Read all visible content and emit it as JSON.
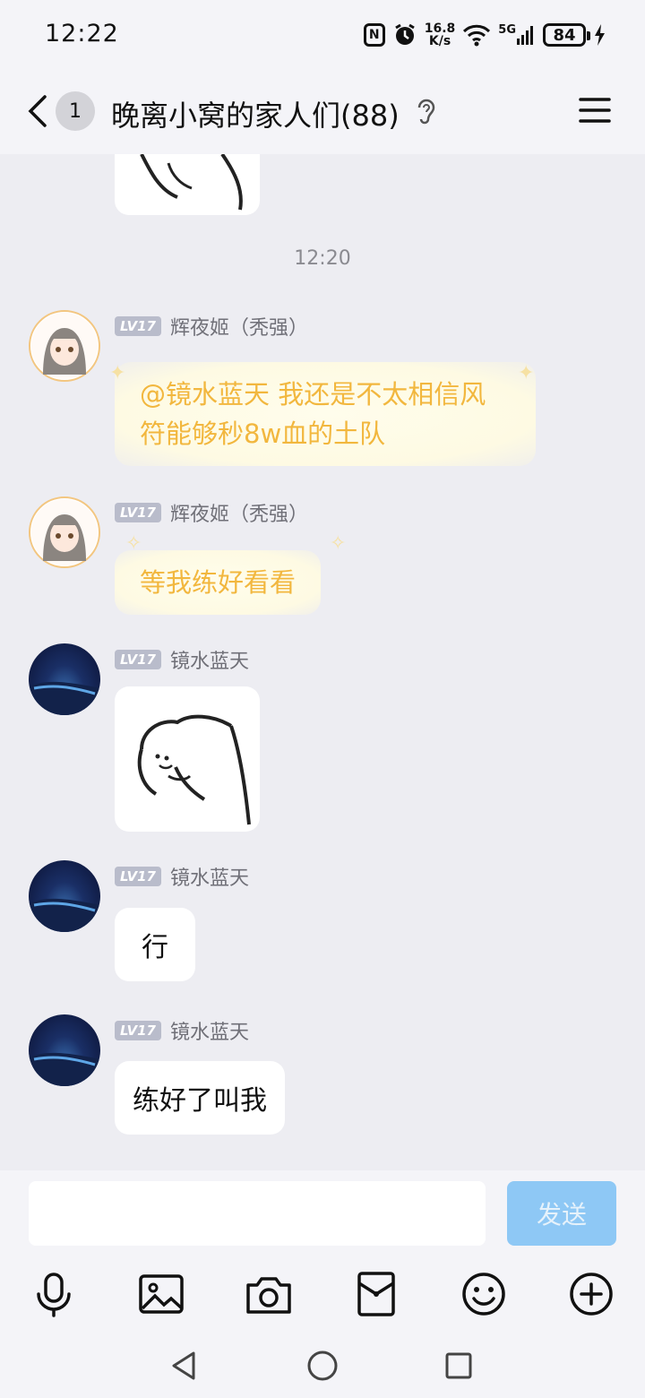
{
  "status_bar": {
    "time": "12:22",
    "nfc": "N",
    "speed_top": "16.8",
    "speed_bottom": "K/s",
    "network": "5G",
    "battery": "84"
  },
  "header": {
    "unread_count": "1",
    "title": "晚离小窝的家人们(88)"
  },
  "messages": {
    "time_divider": "12:20",
    "items": [
      {
        "level": "LV17",
        "sender": "辉夜姬（秃强）",
        "text": "@镜水蓝天 我还是不太相信风符能够秒8w血的土队"
      },
      {
        "level": "LV17",
        "sender": "辉夜姬（秃强）",
        "text": "等我练好看看"
      },
      {
        "level": "LV17",
        "sender": "镜水蓝天"
      },
      {
        "level": "LV17",
        "sender": "镜水蓝天",
        "text": "行"
      },
      {
        "level": "LV17",
        "sender": "镜水蓝天",
        "text": "练好了叫我"
      }
    ]
  },
  "composer": {
    "input_value": "",
    "send_label": "发送"
  },
  "toolbar_icons": [
    "microphone-icon",
    "image-icon",
    "camera-icon",
    "red-packet-icon",
    "emoji-icon",
    "plus-icon"
  ],
  "colors": {
    "accent": "#8ec8f5",
    "fancy_text": "#f2b73e",
    "background": "#ededf2"
  }
}
